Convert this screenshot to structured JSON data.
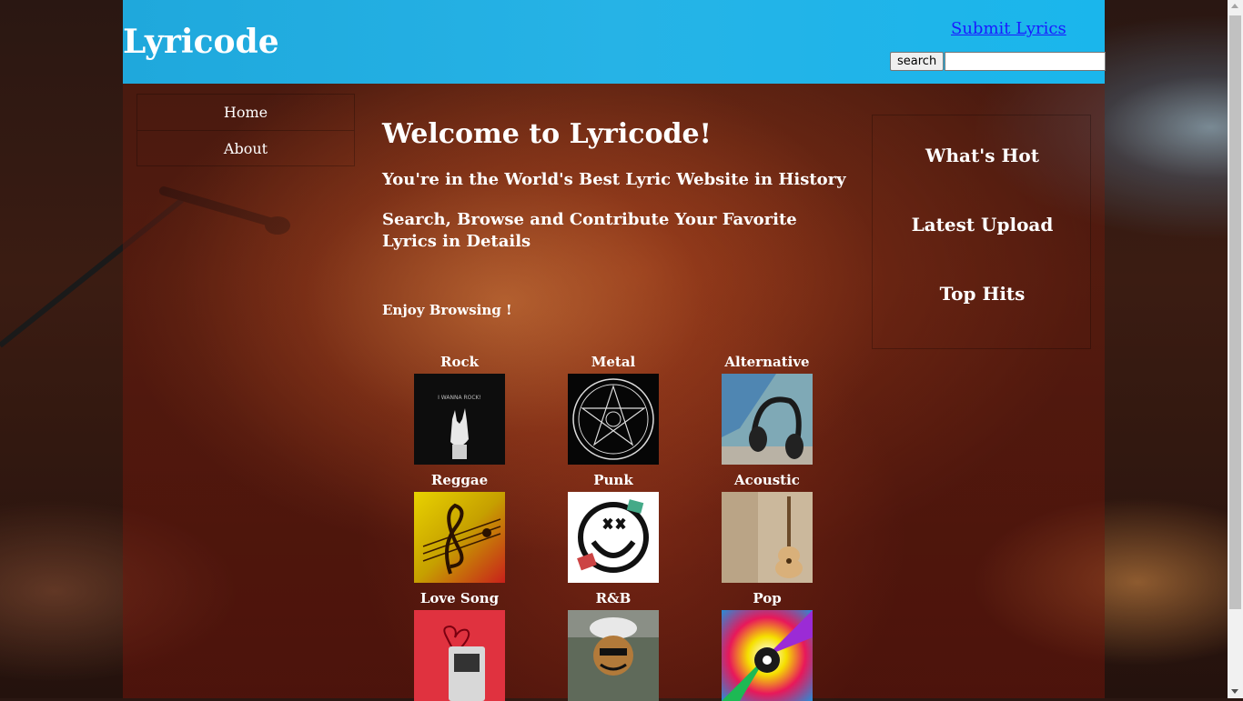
{
  "header": {
    "logo": "Lyricode",
    "submit_link": "Submit Lyrics",
    "search_button": "search",
    "search_value": ""
  },
  "nav": {
    "items": [
      {
        "label": "Home"
      },
      {
        "label": "About"
      }
    ]
  },
  "main": {
    "title": "Welcome to Lyricode!",
    "tagline": "You're in the World's Best Lyric Website in History",
    "subtitle": "Search, Browse and Contribute Your Favorite Lyrics in Details",
    "enjoy": "Enjoy Browsing !"
  },
  "genres": [
    {
      "label": "Rock",
      "icon": "rock-hand-icon"
    },
    {
      "label": "Metal",
      "icon": "pentagram-circle-icon"
    },
    {
      "label": "Alternative",
      "icon": "headphones-icon"
    },
    {
      "label": "Reggae",
      "icon": "treble-clef-icon"
    },
    {
      "label": "Punk",
      "icon": "smiley-logo-icon"
    },
    {
      "label": "Acoustic",
      "icon": "guitar-icon"
    },
    {
      "label": "Love Song",
      "icon": "cassette-heart-icon"
    },
    {
      "label": "R&B",
      "icon": "graffiti-character-icon"
    },
    {
      "label": "Pop",
      "icon": "colorful-music-icon"
    }
  ],
  "aside": {
    "items": [
      {
        "label": "What's Hot"
      },
      {
        "label": "Latest Upload"
      },
      {
        "label": "Top Hits"
      }
    ]
  },
  "colors": {
    "header": "#26b3e6",
    "link": "#1a1aff",
    "text": "#ffffff"
  }
}
